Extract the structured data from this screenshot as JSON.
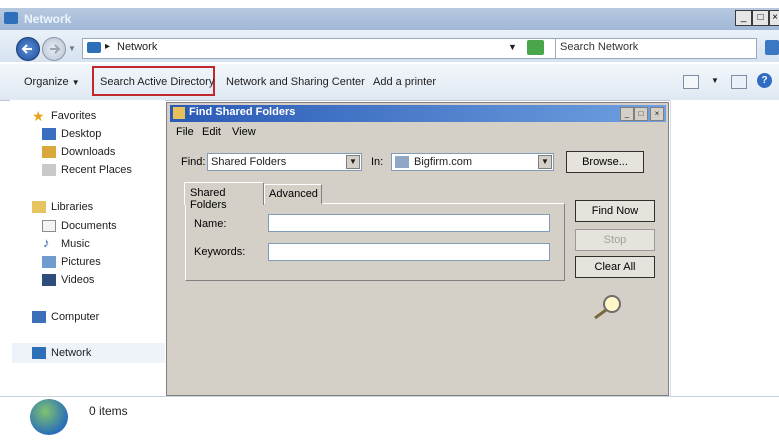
{
  "window": {
    "title": "Network"
  },
  "address": {
    "breadcrumb": "Network",
    "search_placeholder": "Search Network"
  },
  "toolbar": {
    "organize": "Organize",
    "search_ad": "Search Active Directory",
    "network_sharing": "Network and Sharing Center",
    "add_printer": "Add a printer"
  },
  "nav": {
    "favorites": "Favorites",
    "desktop": "Desktop",
    "downloads": "Downloads",
    "recent": "Recent Places",
    "libraries": "Libraries",
    "documents": "Documents",
    "music": "Music",
    "pictures": "Pictures",
    "videos": "Videos",
    "computer": "Computer",
    "network": "Network"
  },
  "dialog": {
    "title": "Find Shared Folders",
    "menu": {
      "file": "File",
      "edit": "Edit",
      "view": "View"
    },
    "find_label": "Find:",
    "find_value": "Shared Folders",
    "in_label": "In:",
    "in_value": "Bigfirm.com",
    "browse": "Browse...",
    "tabs": [
      "Shared Folders",
      "Advanced"
    ],
    "name_label": "Name:",
    "keywords_label": "Keywords:",
    "find_now": "Find Now",
    "stop": "Stop",
    "clear_all": "Clear All"
  },
  "status": {
    "items": "0 items"
  },
  "colors": {
    "highlight_border": "#c0282d",
    "title_blue": "#2a5ab5"
  }
}
